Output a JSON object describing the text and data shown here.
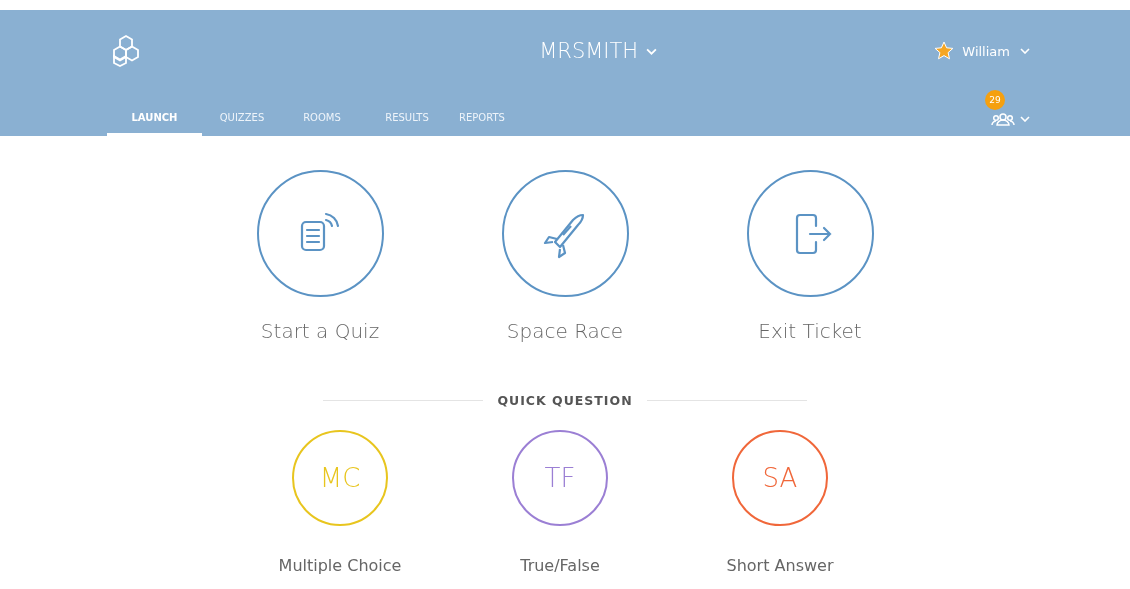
{
  "header": {
    "title": "MRSMITH",
    "user": "William",
    "badge": "29"
  },
  "tabs": [
    {
      "label": "LAUNCH",
      "selected": true
    },
    {
      "label": "QUIZZES",
      "selected": false
    },
    {
      "label": "ROOMS",
      "selected": false
    },
    {
      "label": "RESULTS",
      "selected": false
    },
    {
      "label": "REPORTS",
      "selected": false
    }
  ],
  "activities": [
    {
      "kind": "quiz",
      "label": "Start a Quiz"
    },
    {
      "kind": "race",
      "label": "Space Race"
    },
    {
      "kind": "exit",
      "label": "Exit Ticket"
    }
  ],
  "quick_question": {
    "heading": "QUICK QUESTION",
    "options": [
      {
        "abbr": "MC",
        "label": "Multiple Choice",
        "color": "#e8c51e"
      },
      {
        "abbr": "TF",
        "label": "True/False",
        "color": "#9b7fd4"
      },
      {
        "abbr": "SA",
        "label": "Short Answer",
        "color": "#f0673a"
      }
    ]
  }
}
